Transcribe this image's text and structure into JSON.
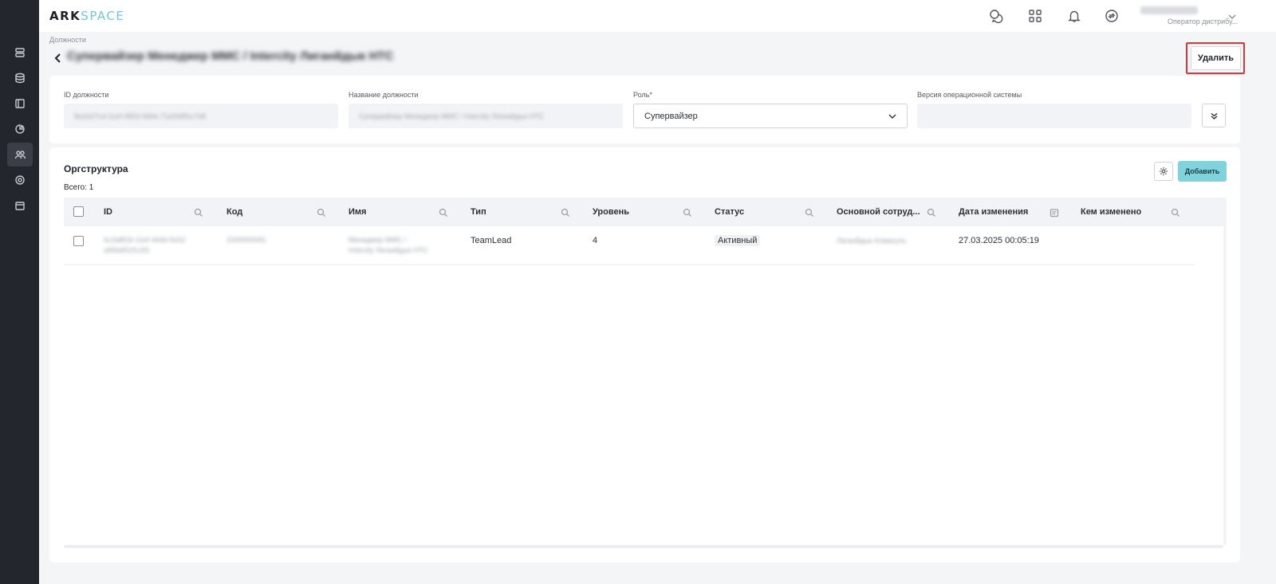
{
  "app": {
    "logo_part1": "ARK",
    "logo_part2": "SPACE",
    "user_name": "Менеджер Ф.",
    "user_role": "Оператор дистрибу..."
  },
  "header": {
    "breadcrumb": "Должности",
    "title": "Супервайзер Менеджер ММС / Intercity Лиганйдык НТС",
    "delete_label": "Удалить"
  },
  "form": {
    "fields": [
      {
        "label": "ID должности",
        "value": "8a1b27cd-11ef-4903-9d0e-71e0b8f1c7d5"
      },
      {
        "label": "Название должности",
        "value": "Супервайзер Менеджер ММС / Intercity Лиганйдык НТС"
      },
      {
        "label": "Роль*",
        "value": "Супервайзер"
      },
      {
        "label": "Версия операционной системы",
        "value": ""
      }
    ]
  },
  "org": {
    "title": "Оргструктура",
    "total": "Всего: 1",
    "add_label": "Добавить",
    "columns": [
      "ID",
      "Код",
      "Имя",
      "Тип",
      "Уровень",
      "Статус",
      "Основной сотруд...",
      "Дата изменения",
      "Кем изменено"
    ],
    "rows": [
      {
        "id_line1": "6c2a8f1b-11ef-4d4d-9c52",
        "id_line2": "a90bd51f1c93",
        "code": "1000000091",
        "name_line1": "Менеджер ММС /",
        "name_line2": "Intercity Лиганйдык НТС",
        "type": "TeamLead",
        "level": "4",
        "status": "Активный",
        "employee": "Лиганйдык Алмагуль",
        "modified": "27.03.2025 00:05:19",
        "modified_by": ""
      }
    ]
  },
  "icons": {
    "sidebar": [
      "server-icon",
      "database-icon",
      "layout-icon",
      "pie-chart-icon",
      "users-icon",
      "settings-icon",
      "calendar-icon"
    ],
    "header": [
      "chat-icon",
      "apps-grid-icon",
      "bell-icon",
      "sync-icon"
    ]
  },
  "colors": {
    "sidebar": "#24262d",
    "accent": "#7fd3dc",
    "logo_accent": "#6ec9d5",
    "highlight": "#e0343b"
  }
}
